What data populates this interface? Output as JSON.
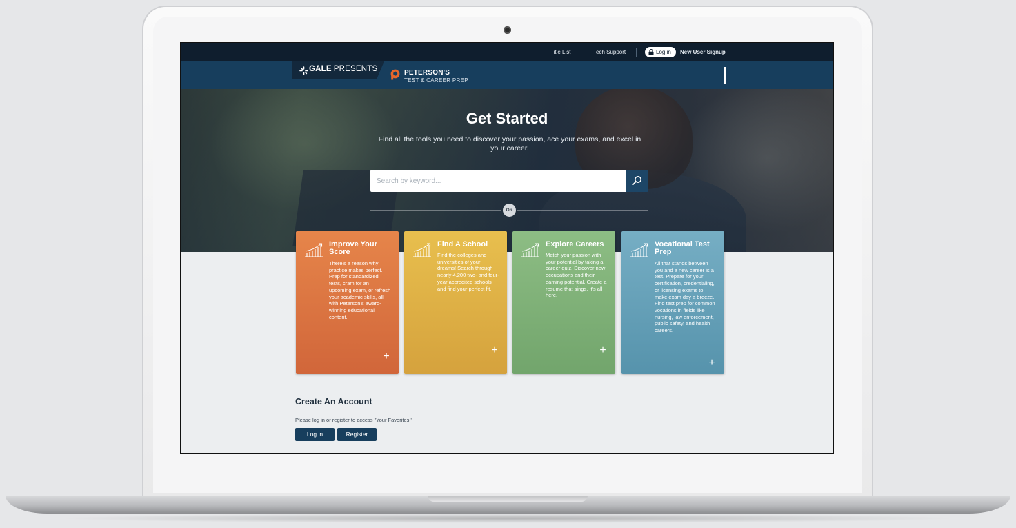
{
  "utility_nav": {
    "title_list": "Title List",
    "tech_support": "Tech Support",
    "log_in": "Log in",
    "new_user_signup": "New User Signup"
  },
  "brand": {
    "gale_prefix": "GALE",
    "gale_suffix": "PRESENTS",
    "petersons_name": "PETERSON'S",
    "petersons_sub": "TEST & CAREER PREP",
    "accent_color": "#e8672b",
    "navy": "#173e5d"
  },
  "hero": {
    "title": "Get Started",
    "subtitle": "Find all the tools you need to discover your passion, ace your exams, and excel in your career.",
    "search_placeholder": "Search by keyword...",
    "or_label": "OR"
  },
  "cards": [
    {
      "title": "Improve Your Score",
      "description": "There's a reason why practice makes perfect. Prep for standardized tests, cram for an upcoming exam, or refresh your academic skills, all with Peterson's award-winning educational content.",
      "icon": "growth-chart-icon",
      "color": "#e07a45",
      "plus": "+"
    },
    {
      "title": "Find A School",
      "description": "Find the colleges and universities of your dreams! Search through nearly 4,200 two- and four-year accredited schools and find your perfect fit.",
      "icon": "growth-chart-icon",
      "color": "#e2b448",
      "plus": "+"
    },
    {
      "title": "Explore Careers",
      "description": "Match your passion with your potential by taking a career quiz. Discover new occupations and their earning potential. Create a resume that sings. It's all here.",
      "icon": "growth-chart-icon",
      "color": "#84b47c",
      "plus": "+"
    },
    {
      "title": "Vocational Test Prep",
      "description": "All that stands between you and a new career is a test. Prepare for your certification, credentialing, or licensing exams to make exam day a breeze. Find test prep for common vocations in fields like nursing, law enforcement, public safety, and health careers.",
      "icon": "growth-chart-icon",
      "color": "#6aa4bb",
      "plus": "+"
    }
  ],
  "account": {
    "title": "Create An Account",
    "text": "Please log in or register to access \"Your Favorites.\"",
    "login_label": "Log in",
    "register_label": "Register"
  }
}
